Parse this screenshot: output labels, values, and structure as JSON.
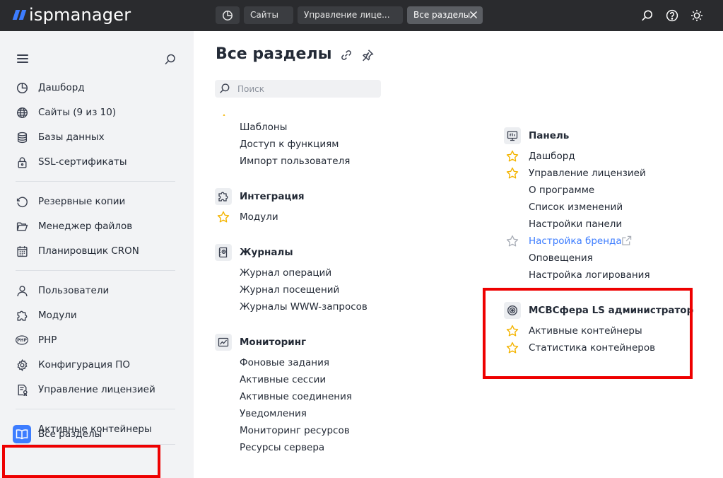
{
  "app": {
    "logo_text": "ispmanager",
    "brand_color": "#3d7dff",
    "highlight_color": "#ee0000"
  },
  "topbar": {
    "tabs": [
      {
        "label": "Сайты"
      },
      {
        "label": "Управление лице..."
      },
      {
        "label": "Все разделы",
        "active": true
      }
    ],
    "icons": [
      "dashboard-icon",
      "search-icon",
      "help-icon",
      "theme-icon"
    ]
  },
  "sidebar": {
    "items": [
      {
        "label": "Дашборд",
        "icon": "dashboard-icon"
      },
      {
        "label": "Сайты (9 из 10)",
        "icon": "globe-icon"
      },
      {
        "label": "Базы данных",
        "icon": "database-icon"
      },
      {
        "label": "SSL-сертификаты",
        "icon": "lock-icon"
      },
      {
        "label": "Резервные копии",
        "icon": "backup-icon"
      },
      {
        "label": "Менеджер файлов",
        "icon": "folder-icon"
      },
      {
        "label": "Планировщик CRON",
        "icon": "calendar-icon"
      },
      {
        "label": "Пользователи",
        "icon": "user-icon"
      },
      {
        "label": "Модули",
        "icon": "puzzle-icon"
      },
      {
        "label": "PHP",
        "icon": "php-icon"
      },
      {
        "label": "Конфигурация ПО",
        "icon": "gear-icon"
      },
      {
        "label": "Управление лицензией",
        "icon": "license-icon"
      },
      {
        "label": "Активные контейнеры",
        "icon": "monitor-chart-icon"
      }
    ],
    "active_item": {
      "label": "Все разделы",
      "icon": "book-icon"
    }
  },
  "main": {
    "title": "Все разделы",
    "search_placeholder": "Поиск",
    "left_column": {
      "top_links": [
        "Шаблоны",
        "Доступ к функциям",
        "Импорт пользователя"
      ],
      "sections": [
        {
          "title": "Интеграция",
          "icon": "puzzle-icon",
          "links": [
            {
              "label": "Модули",
              "starred": true
            }
          ]
        },
        {
          "title": "Журналы",
          "icon": "journal-icon",
          "links": [
            {
              "label": "Журнал операций"
            },
            {
              "label": "Журнал посещений"
            },
            {
              "label": "Журналы WWW-запросов"
            }
          ]
        },
        {
          "title": "Мониторинг",
          "icon": "monitor-chart-icon",
          "links": [
            {
              "label": "Фоновые задания"
            },
            {
              "label": "Активные сессии"
            },
            {
              "label": "Активные соединения"
            },
            {
              "label": "Уведомления"
            },
            {
              "label": "Мониторинг ресурсов"
            },
            {
              "label": "Ресурсы сервера"
            }
          ]
        }
      ]
    },
    "right_column": {
      "sections": [
        {
          "title": "Панель",
          "icon": "panel-icon",
          "links": [
            {
              "label": "Дашборд",
              "starred": true
            },
            {
              "label": "Управление лицензией",
              "starred": true
            },
            {
              "label": "О программе"
            },
            {
              "label": "Список изменений"
            },
            {
              "label": "Настройки панели"
            },
            {
              "label": "Настройка бренда",
              "starred_outline": true,
              "link": true
            },
            {
              "label": "Оповещения"
            },
            {
              "label": "Настройка логирования"
            }
          ]
        },
        {
          "title": "МСВСфера LS администратор",
          "icon": "target-icon",
          "links": [
            {
              "label": "Активные контейнеры",
              "starred": true
            },
            {
              "label": "Статистика контейнеров",
              "starred": true
            }
          ]
        }
      ]
    }
  }
}
